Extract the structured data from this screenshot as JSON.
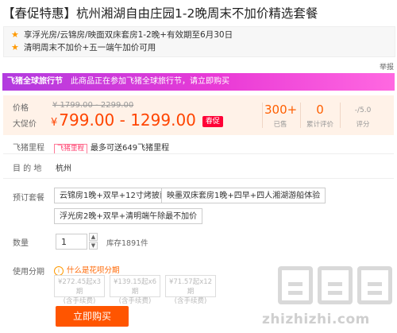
{
  "title": "【春促特惠】杭州湘湖自由庄园1-2晚周末不加价精选套餐",
  "promos": [
    "享浮光房/云锦房/映面双床套房1-2晚+有效期至6月30日",
    "清明周末不加价+五一端午加价可用"
  ],
  "report_label": "举报",
  "banner": {
    "brand": "飞猪全球旅行节",
    "text": "此商品正在参加飞猪全球旅行节，请立即购买"
  },
  "price": {
    "original_label": "价格",
    "original_value": "¥ 1799.00 - 2299.00",
    "promo_label": "大促价",
    "currency": "¥",
    "promo_value": "799.00 - 1299.00",
    "promo_tag": "春促",
    "sales_value": "300+",
    "sales_label": "已售",
    "reviews_value": "0",
    "reviews_label": "累计评价",
    "rating_value": "-/5.0",
    "rating_label": "评分"
  },
  "mileage": {
    "label": "飞猪里程",
    "tag": "飞猪里程",
    "text": "最多可送649飞猪里程"
  },
  "destination": {
    "label": "目 的 地",
    "value": "杭州"
  },
  "package": {
    "label": "预订套餐",
    "options": [
      "云锦房1晚+双早+12寸烤披萨",
      "映墨双床套房1晚+四早+四人湘湖游船体验",
      "浮光房2晚+双早+清明端午除最不加价"
    ]
  },
  "quantity": {
    "label": "数量",
    "value": "1",
    "up": "▲",
    "down": "▼",
    "stock": "库存1891件"
  },
  "installment": {
    "label": "使用分期",
    "link": "什么是花呗分期",
    "icon": "i",
    "options": [
      {
        "price": "¥272.45起x3期",
        "note": "(含手续费)"
      },
      {
        "price": "¥139.15起x6期",
        "note": "(含手续费)"
      },
      {
        "price": "¥71.57起x12期",
        "note": "(含手续费)"
      }
    ]
  },
  "buy_button": "立即购买",
  "watermark": {
    "text": "zhizhizhi.com",
    "logo_alt": "值值值"
  },
  "colors": {
    "accent": "#ff4400",
    "buy": "#ff5500",
    "banner_start": "#b23bdf",
    "banner_end": "#ff68e1",
    "price_panel": "#fff2e8"
  }
}
